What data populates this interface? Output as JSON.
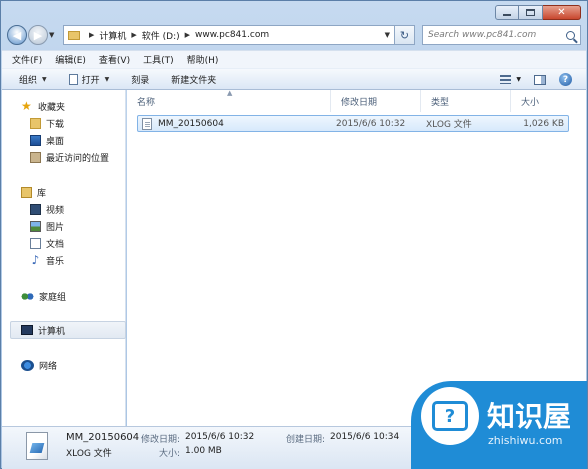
{
  "address": {
    "crumbs": [
      "计算机",
      "软件 (D:)",
      "www.pc841.com"
    ]
  },
  "search": {
    "placeholder": "Search www.pc841.com"
  },
  "menu": [
    "文件(F)",
    "编辑(E)",
    "查看(V)",
    "工具(T)",
    "帮助(H)"
  ],
  "commands": {
    "organize": "组织",
    "open": "打开",
    "burn": "刻录",
    "new_folder": "新建文件夹"
  },
  "nav": {
    "favorites": "收藏夹",
    "downloads": "下载",
    "desktop": "桌面",
    "recent": "最近访问的位置",
    "libraries": "库",
    "videos": "视频",
    "pictures": "图片",
    "documents": "文档",
    "music": "音乐",
    "homegroup": "家庭组",
    "computer": "计算机",
    "network": "网络"
  },
  "columns": {
    "name": "名称",
    "modified": "修改日期",
    "type": "类型",
    "size": "大小"
  },
  "files": [
    {
      "name": "MM_20150604",
      "modified": "2015/6/6 10:32",
      "type": "XLOG 文件",
      "size": "1,026 KB"
    }
  ],
  "details": {
    "name": "MM_20150604",
    "type": "XLOG 文件",
    "modified_label": "修改日期:",
    "modified": "2015/6/6 10:32",
    "created_label": "创建日期:",
    "created": "2015/6/6 10:34",
    "size_label": "大小:",
    "size": "1.00 MB"
  },
  "watermark": {
    "title": "知识屋",
    "url": "zhishiwu.com",
    "icon_glyph": "?"
  },
  "colors": {
    "accent": "#1f8cd6",
    "selection": "#d7e9fb"
  }
}
